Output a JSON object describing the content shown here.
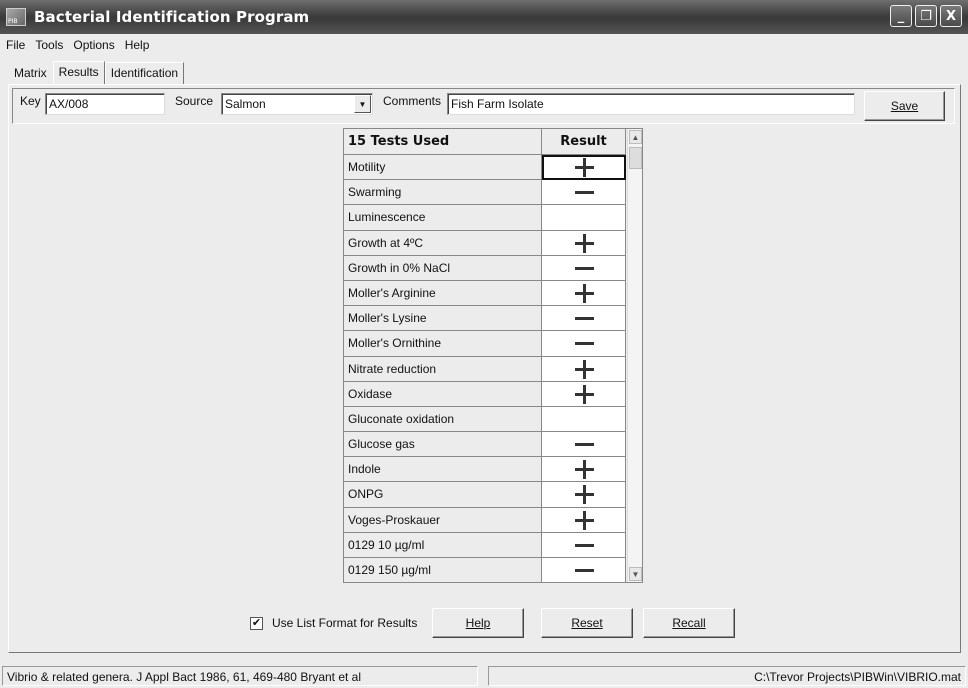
{
  "window": {
    "title": "Bacterial Identification Program",
    "minimize_glyph": "_",
    "restore_glyph": "❐",
    "close_glyph": "X"
  },
  "menu": [
    "File",
    "Tools",
    "Options",
    "Help"
  ],
  "tabs": [
    "Matrix",
    "Results",
    "Identification"
  ],
  "active_tab": "Results",
  "fields": {
    "key_label": "Key",
    "key_value": "AX/008",
    "source_label": "Source",
    "source_value": "Salmon",
    "comments_label": "Comments",
    "comments_value": "Fish Farm Isolate",
    "save_label": "Save"
  },
  "table": {
    "col_name_header": "15 Tests Used",
    "col_result_header": "Result",
    "rows": [
      {
        "name": "Motility",
        "result": "+"
      },
      {
        "name": "Swarming",
        "result": "-"
      },
      {
        "name": "Luminescence",
        "result": ""
      },
      {
        "name": "Growth at 4ºC",
        "result": "+"
      },
      {
        "name": "Growth in 0% NaCl",
        "result": "-"
      },
      {
        "name": "Moller's Arginine",
        "result": "+"
      },
      {
        "name": "Moller's Lysine",
        "result": "-"
      },
      {
        "name": "Moller's Ornithine",
        "result": "-"
      },
      {
        "name": "Nitrate reduction",
        "result": "+"
      },
      {
        "name": "Oxidase",
        "result": "+"
      },
      {
        "name": "Gluconate oxidation",
        "result": ""
      },
      {
        "name": "Glucose gas",
        "result": "-"
      },
      {
        "name": "Indole",
        "result": "+"
      },
      {
        "name": "ONPG",
        "result": "+"
      },
      {
        "name": "Voges-Proskauer",
        "result": "+"
      },
      {
        "name": "0129 10 µg/ml",
        "result": "-"
      },
      {
        "name": "0129 150 µg/ml",
        "result": "-"
      }
    ]
  },
  "bottom": {
    "list_format_label": "Use List Format for Results",
    "list_format_checked": true,
    "help_label": "Help",
    "reset_label": "Reset",
    "recall_label": "Recall"
  },
  "statusbar": {
    "left": "Vibrio & related genera. J Appl Bact 1986, 61, 469-480 Bryant et al",
    "right": "C:\\Trevor Projects\\PIBWin\\VIBRIO.mat"
  }
}
